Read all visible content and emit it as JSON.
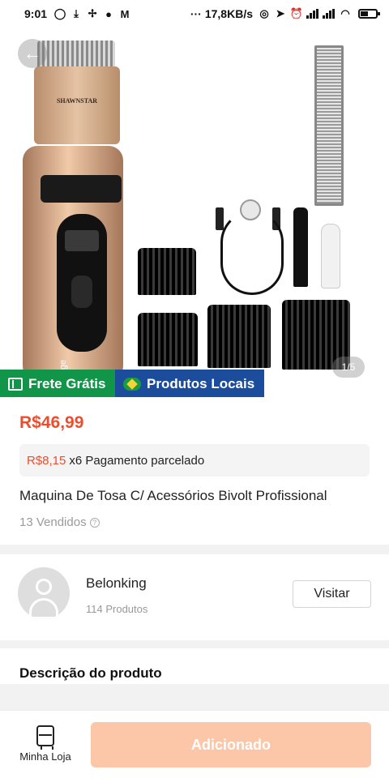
{
  "status_bar": {
    "time": "9:01",
    "network_speed": "17,8KB/s"
  },
  "gallery": {
    "page_indicator": "1/5",
    "clipper_brand": "SHAWNSTAR",
    "clipper_label": "Charge"
  },
  "tags": {
    "shipping": "Frete Grátis",
    "local": "Produtos Locais"
  },
  "product": {
    "price": "R$46,99",
    "installment_amount": "R$8,15",
    "installment_text": "x6 Pagamento parcelado",
    "title": "Maquina De Tosa C/ Acessórios Bivolt Profissional",
    "sold": "13 Vendidos"
  },
  "shop": {
    "name": "Belonking",
    "products": "114 Produtos",
    "visit_label": "Visitar"
  },
  "description": {
    "title": "Descrição do produto"
  },
  "bottom_bar": {
    "store_label": "Minha Loja",
    "add_label": "Adicionado"
  },
  "colors": {
    "accent": "#ee4d2d",
    "free_shipping": "#119548",
    "local_products": "#1b4d9c",
    "add_button_disabled": "#fcc6a8"
  }
}
